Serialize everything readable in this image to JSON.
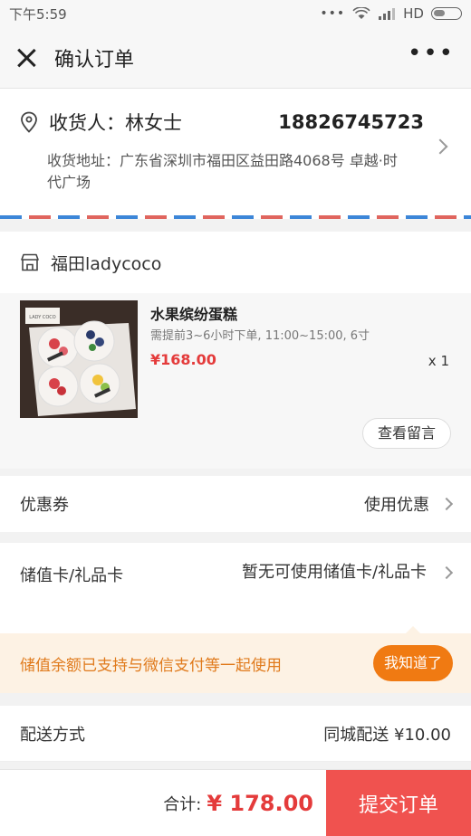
{
  "status_bar": {
    "time": "下午5:59",
    "dots": "•••",
    "network": "HD"
  },
  "nav": {
    "title": "确认订单",
    "more": "•••"
  },
  "address": {
    "recipient": "收货人：林女士",
    "phone": "18826745723",
    "detail": "收货地址：广东省深圳市福田区益田路4068号 卓越·时代广场"
  },
  "shop": {
    "name": "福田ladycoco"
  },
  "product": {
    "image_label": "LADY COCO",
    "name": "水果缤纷蛋糕",
    "spec": "需提前3~6小时下单, 11:00~15:00, 6寸",
    "price": "¥168.00",
    "quantity": "x 1",
    "note_button": "查看留言"
  },
  "coupon": {
    "label": "优惠券",
    "value": "使用优惠"
  },
  "giftcard": {
    "label": "储值卡/礼品卡",
    "value": "暂无可使用储值卡/礼品卡"
  },
  "tip": {
    "text": "储值余额已支持与微信支付等一起使用",
    "button": "我知道了"
  },
  "delivery": {
    "label": "配送方式",
    "value": "同城配送 ¥10.00"
  },
  "footer": {
    "total_label": "合计:",
    "total_amount": "¥ 178.00",
    "submit": "提交订单"
  },
  "colors": {
    "price_red": "#e43b3b",
    "submit_red": "#f0524f",
    "tip_orange": "#f07a12",
    "stripe_blue": "#3c86d8",
    "stripe_red": "#e0655e"
  }
}
